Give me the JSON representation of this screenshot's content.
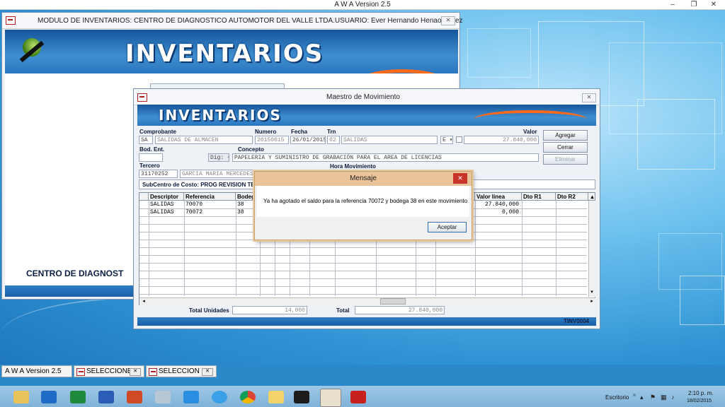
{
  "app": {
    "title": "A W A Version 2.5"
  },
  "main_window": {
    "title": "MODULO DE INVENTARIOS: CENTRO DE DIAGNOSTICO AUTOMOTOR DEL VALLE LTDA.USUARIO: Ever Hernando Henao Lopez",
    "banner": "INVENTARIOS",
    "footer_text": "CENTRO DE DIAGNOST"
  },
  "movement_window": {
    "title": "Maestro de Movimiento",
    "banner": "INVENTARIOS",
    "labels": {
      "comprobante": "Comprobante",
      "numero": "Numero",
      "fecha": "Fecha",
      "trn": "Trn",
      "valor": "Valor",
      "bod_ent": "Bod. Ent.",
      "concepto": "Concepto",
      "tercero": "Tercero",
      "hora_movimiento": "Hora Movimiento",
      "subcentro": "SubCentro de Costo: PROG REVISION TEC"
    },
    "fields": {
      "comprobante_code": "SA",
      "comprobante_desc": "SALIDAS DE ALMACEN",
      "numero": "20150015",
      "fecha": "26/01/2015",
      "trn_code": "02",
      "trn_desc": "SALIDAS",
      "e_select": "E",
      "valor": "27.840,000",
      "dig_select": "Dig:",
      "concepto": "PAPELERIA Y SUMINISTRO DE GRABACIÓN PARA EL AREA DE LICENCIAS",
      "tercero_code": "31170252",
      "tercero_name": "GARCIA  MARIA MERCEDES"
    },
    "buttons": {
      "agregar": "Agregar",
      "cerrar": "Cerrar",
      "eliminar": "Eliminar"
    },
    "grid": {
      "headers": {
        "descriptor": "Descriptor",
        "referencia": "Referencia",
        "bodega": "Bodega",
        "valor_linea": "Valor linea",
        "dto_r1": "Dto R1",
        "dto_r2": "Dto R2"
      },
      "rows": [
        {
          "descriptor": "SALIDAS",
          "referencia": "70070",
          "bodega": "38",
          "valor_linea": "27.840,000"
        },
        {
          "descriptor": "SALIDAS",
          "referencia": "70072",
          "bodega": "38",
          "valor_linea": "0,000"
        }
      ]
    },
    "totals": {
      "unidades_label": "Total Unidades",
      "unidades": "14,000",
      "total_label": "Total",
      "total": "27.840,000"
    },
    "status_code": "TINV0004"
  },
  "dialog": {
    "title": "Mensaje",
    "message": "Ya ha agotado el saldo para la referencia 70072 y bodega 38 en este movimiento",
    "ok": "Aceptar"
  },
  "tabs": [
    {
      "label": "A W A Version 2.5"
    },
    {
      "label": "SELECCIONE..."
    },
    {
      "label": "SELECCION ..."
    }
  ],
  "taskbar": {
    "escritorio": "Escritorio",
    "time": "2:10 p. m.",
    "date": "18/02/2015"
  }
}
